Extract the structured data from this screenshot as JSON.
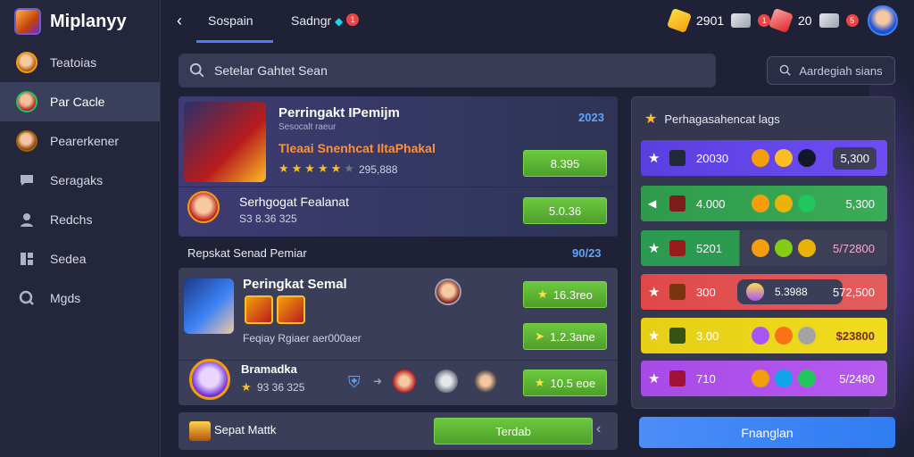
{
  "app": {
    "name": "Miplanyy"
  },
  "sidebar": {
    "items": [
      {
        "label": "Teatoias",
        "icon": "hero-avatar-icon"
      },
      {
        "label": "Par Cacle",
        "icon": "hero-avatar-icon",
        "active": true
      },
      {
        "label": "Pearerkener",
        "icon": "hero-avatar-icon"
      },
      {
        "label": "Seragaks",
        "icon": "chat-icon"
      },
      {
        "label": "Redchs",
        "icon": "user-icon"
      },
      {
        "label": "Sedea",
        "icon": "grid-icon"
      },
      {
        "label": "Mgds",
        "icon": "gear-icon"
      }
    ]
  },
  "topbar": {
    "tabs": [
      {
        "label": "Sospain",
        "active": true
      },
      {
        "label": "Sadngr",
        "badge": "1"
      }
    ],
    "currencies": [
      {
        "icon": "coin-icon",
        "value": "2901",
        "badge": "1"
      },
      {
        "icon": "cash-icon",
        "value": "20",
        "badge": "5"
      }
    ]
  },
  "search": {
    "placeholder": "Setelar Gahtet Sean",
    "right_label": "Aardegiah sians"
  },
  "featured": {
    "title": "Perringakt IPemijm",
    "subtitle": "Sesocalt raeur",
    "year": "2023",
    "highlight": "Tleaai Snenhcat IltaPhakal",
    "rating_text": "295,888",
    "stars_on": 5,
    "stars_total": 6,
    "button1": "8.395",
    "item2_title": "Serhgogat Fealanat",
    "item2_meta": "S3 8.36 325",
    "button2": "5.0.36"
  },
  "section": {
    "label": "Repskat Senad Pemiar",
    "year": "90/23"
  },
  "second": {
    "title": "Peringkat Semal",
    "meta": "Feqiay Rgiaer aer000aer",
    "button1": "16.3reo",
    "button2": "1.2.3ane",
    "item2_title": "Bramadka",
    "item2_meta": "93 36 325",
    "button3": "10.5 eoe"
  },
  "bottom": {
    "label": "Sepat Mattk",
    "button": "Terdab"
  },
  "right_panel": {
    "title": "Perhagasahencat lags",
    "rows": [
      {
        "num": "20030",
        "value": "5,300",
        "color": "#6e4df2"
      },
      {
        "num": "4.000",
        "value": "5,300",
        "color": "#36a853"
      },
      {
        "num": "5201",
        "value": "5/72800",
        "color": "#2d9a52"
      },
      {
        "num": "300",
        "mid": "5.3988",
        "value": "572,500",
        "color": "#e04848"
      },
      {
        "num": "3.00",
        "value": "$23800",
        "color": "#f0dc1f"
      },
      {
        "num": "710",
        "value": "5/2480",
        "color": "#b75af0"
      }
    ]
  },
  "action_button": {
    "label": "Fnanglan"
  }
}
